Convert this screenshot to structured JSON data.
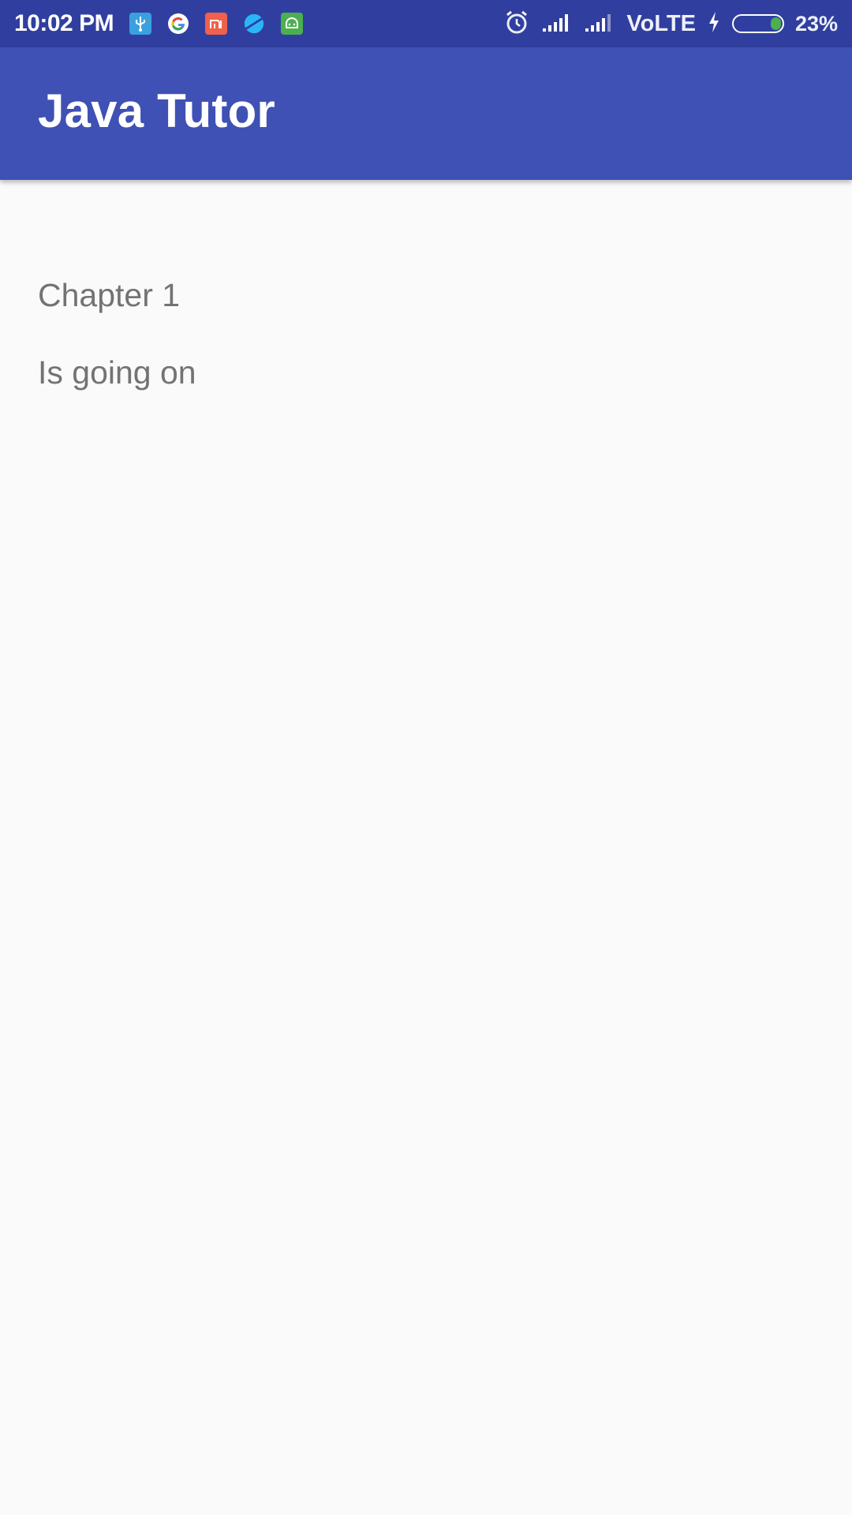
{
  "status_bar": {
    "time": "10:02 PM",
    "notification_icons": [
      "usb-icon",
      "google-icon",
      "mi-icon",
      "browser-icon",
      "android-icon"
    ],
    "system_icons": [
      "alarm-icon",
      "signal-icon",
      "signal-icon"
    ],
    "network": "VoLTE",
    "battery_percent_text": "23%",
    "battery_level": 0.23,
    "charging": true
  },
  "app_bar": {
    "title": "Java Tutor",
    "color": "#3f51b5"
  },
  "content": {
    "line1": "Chapter 1",
    "line2": "Is going on"
  }
}
